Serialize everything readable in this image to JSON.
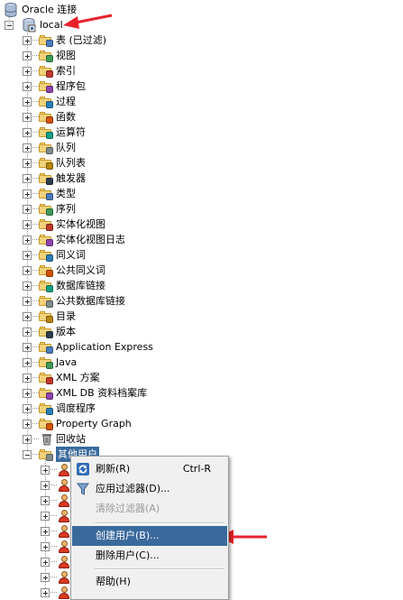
{
  "root": {
    "label": "Oracle 连接"
  },
  "connection": {
    "label": "local"
  },
  "nodes": [
    "表 (已过滤)",
    "视图",
    "索引",
    "程序包",
    "过程",
    "函数",
    "运算符",
    "队列",
    "队列表",
    "触发器",
    "类型",
    "序列",
    "实体化视图",
    "实体化视图日志",
    "同义词",
    "公共同义词",
    "数据库链接",
    "公共数据库链接",
    "目录",
    "版本",
    "Application Express",
    "Java",
    "XML 方案",
    "XML DB 资料档案库",
    "调度程序",
    "Property Graph",
    "回收站",
    "其他用户"
  ],
  "node_icons": [
    "table-folder-icon",
    "view-folder-icon",
    "index-folder-icon",
    "package-folder-icon",
    "procedure-folder-icon",
    "function-folder-icon",
    "operator-folder-icon",
    "queue-folder-icon",
    "queue-table-folder-icon",
    "trigger-folder-icon",
    "type-folder-icon",
    "sequence-folder-icon",
    "materialized-view-folder-icon",
    "materialized-view-log-folder-icon",
    "synonym-folder-icon",
    "public-synonym-folder-icon",
    "db-link-folder-icon",
    "public-db-link-folder-icon",
    "directory-folder-icon",
    "edition-folder-icon",
    "apex-folder-icon",
    "java-folder-icon",
    "xml-schema-folder-icon",
    "xml-db-folder-icon",
    "scheduler-folder-icon",
    "property-graph-folder-icon",
    "recycle-bin-icon",
    "other-users-folder-icon"
  ],
  "colors": {
    "menu_highlight": "#3a6a9c",
    "annotation_arrow": "#e8222c",
    "folder": "#f2d27a"
  },
  "context_menu": {
    "items": [
      {
        "label": "刷新(R)",
        "shortcut": "Ctrl-R",
        "icon": "refresh-icon",
        "enabled": true
      },
      {
        "label": "应用过滤器(D)...",
        "icon": "filter-icon",
        "enabled": true
      },
      {
        "label": "清除过滤器(A)",
        "icon": "",
        "enabled": false
      },
      {
        "label": "创建用户(B)...",
        "icon": "",
        "enabled": true,
        "highlighted": true
      },
      {
        "label": "删除用户(C)...",
        "icon": "",
        "enabled": true
      },
      {
        "label": "帮助(H)",
        "icon": "",
        "enabled": true
      }
    ]
  }
}
